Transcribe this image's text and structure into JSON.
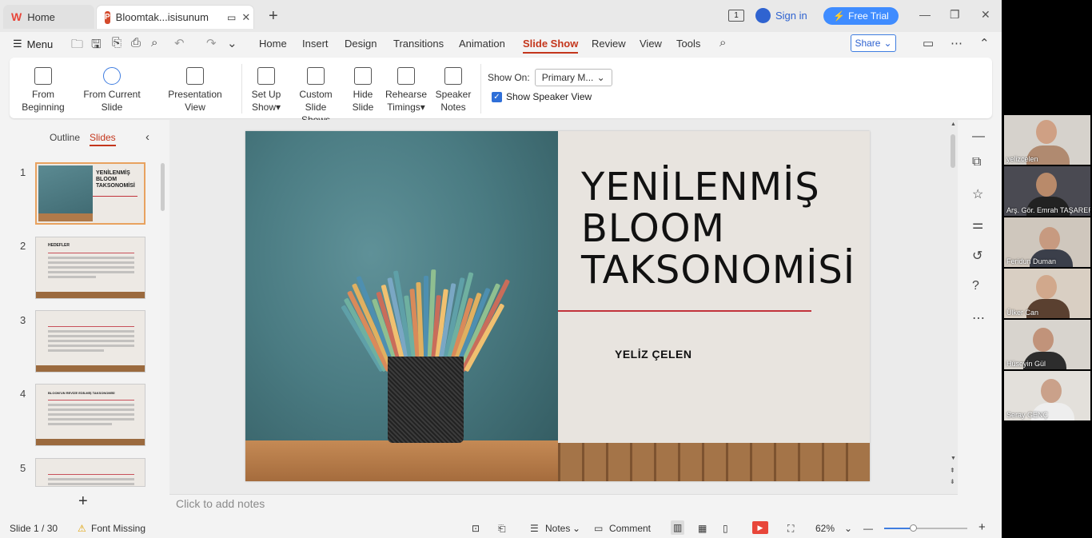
{
  "tabs": {
    "home": "Home",
    "doc": "Bloomtak...isisunum"
  },
  "titlebar": {
    "sign_in": "Sign in",
    "free_trial": "Free Trial",
    "slide_counter_badge": "1"
  },
  "menubar": {
    "menu": "Menu",
    "tabs": [
      "Home",
      "Insert",
      "Design",
      "Transitions",
      "Animation",
      "Slide Show",
      "Review",
      "View",
      "Tools"
    ],
    "active": "Slide Show",
    "share": "Share"
  },
  "ribbon": {
    "from_beginning": [
      "From",
      "Beginning"
    ],
    "from_current": "From Current Slide",
    "presentation_view": "Presentation View",
    "set_up_show": [
      "Set Up",
      "Show"
    ],
    "custom_slide_shows": [
      "Custom",
      "Slide Shows"
    ],
    "hide_slide": [
      "Hide",
      "Slide"
    ],
    "rehearse_timings": [
      "Rehearse",
      "Timings"
    ],
    "speaker_notes": [
      "Speaker",
      "Notes"
    ],
    "show_on_label": "Show On:",
    "show_on_value": "Primary M...",
    "show_speaker_view": "Show Speaker View",
    "show_speaker_view_checked": true
  },
  "leftpane": {
    "outline": "Outline",
    "slides": "Slides",
    "slide_numbers": [
      "1",
      "2",
      "3",
      "4",
      "5"
    ],
    "thumb1_title": [
      "YENİLENMİŞ",
      "BLOOM",
      "TAKSONOMİSİ"
    ],
    "thumb2_heading": "HEDEFLER",
    "thumb4_heading": "BLOOM'UN REVİZE EDİLMİŞ TAKSONOMİSİ"
  },
  "slide": {
    "title_lines": [
      "YENİLENMİŞ",
      "BLOOM",
      "TAKSONOMİSİ"
    ],
    "author": "YELİZ ÇELEN"
  },
  "notes_placeholder": "Click to add notes",
  "status": {
    "slide": "Slide 1 / 30",
    "font_missing": "Font Missing",
    "notes": "Notes",
    "comment": "Comment",
    "zoom": "62%",
    "zoom_level_percent": 62
  },
  "participants": [
    "yelizcelen",
    "Arş. Gör. Emrah TAŞARER",
    "Feridun Duman",
    "Ülker Can",
    "Hüseyin Gül",
    "Seray GENÇ"
  ]
}
